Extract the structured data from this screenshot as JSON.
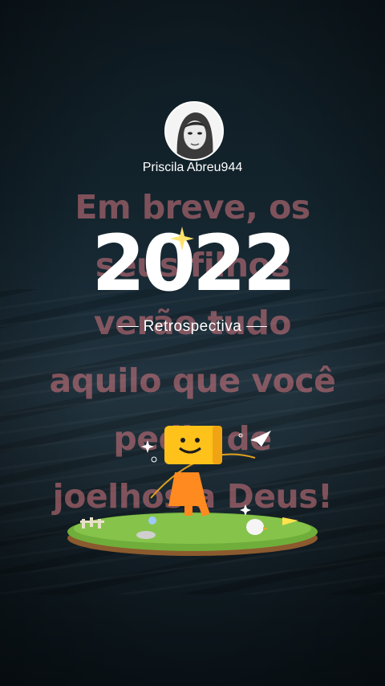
{
  "profile": {
    "username": "Priscila Abreu944"
  },
  "overlay": {
    "lines": [
      "Em breve, os",
      "seus filhos",
      "verão tudo",
      "aquilo que você",
      "pediu de",
      "joelhos a Deus!"
    ]
  },
  "retrospective": {
    "year": "2022",
    "label": "Retrospectiva"
  }
}
